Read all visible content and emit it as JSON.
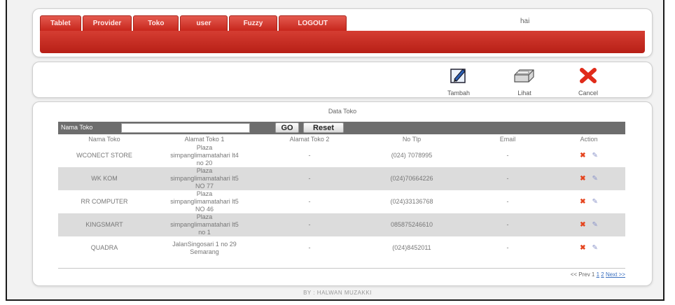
{
  "header": {
    "tabs": [
      "Tablet",
      "Provider",
      "Toko",
      "user",
      "Fuzzy",
      "LOGOUT"
    ],
    "greeting": "hai"
  },
  "toolbar": {
    "tambah": "Tambah",
    "lihat": "Lihat",
    "cancel": "Cancel"
  },
  "data": {
    "title": "Data Toko",
    "search_label": "Nama Toko",
    "search_value": "",
    "go_label": "GO",
    "reset_label": "Reset",
    "columns": [
      "Nama Toko",
      "Alamat Toko 1",
      "Alamat Toko 2",
      "No Tlp",
      "Email",
      "Action"
    ],
    "rows": [
      {
        "nama": "WCONECT STORE",
        "alamat1_lines": [
          "Plaza",
          "simpanglimamatahari lt4",
          "no 20"
        ],
        "alamat2": "-",
        "tlp": "(024) 7078995",
        "email": "-"
      },
      {
        "nama": "WK KOM",
        "alamat1_lines": [
          "Plaza",
          "simpanglimamatahari lt5",
          "NO 77"
        ],
        "alamat2": "-",
        "tlp": "(024)70664226",
        "email": "-"
      },
      {
        "nama": "RR COMPUTER",
        "alamat1_lines": [
          "Plaza",
          "simpanglimamatahari lt5",
          "NO 46"
        ],
        "alamat2": "-",
        "tlp": "(024)33136768",
        "email": "-"
      },
      {
        "nama": "KINGSMART",
        "alamat1_lines": [
          "Plaza",
          "simpanglimamatahari lt5",
          "no 1"
        ],
        "alamat2": "-",
        "tlp": "085875246610",
        "email": "-"
      },
      {
        "nama": "QUADRA",
        "alamat1_lines": [
          "JalanSingosari 1 no 29",
          "Semarang"
        ],
        "alamat2": "-",
        "tlp": "(024)8452011",
        "email": "-"
      }
    ],
    "pager": {
      "prefix": "<< Prev 1",
      "link1": "1",
      "link2": "2",
      "next": "Next >>"
    }
  },
  "footer": "BY : HALWAN MUZAKKI",
  "colors": {
    "accent": "#c7261c",
    "header_bar": "#6d6d6d",
    "alt_row": "#dcdcdc"
  }
}
